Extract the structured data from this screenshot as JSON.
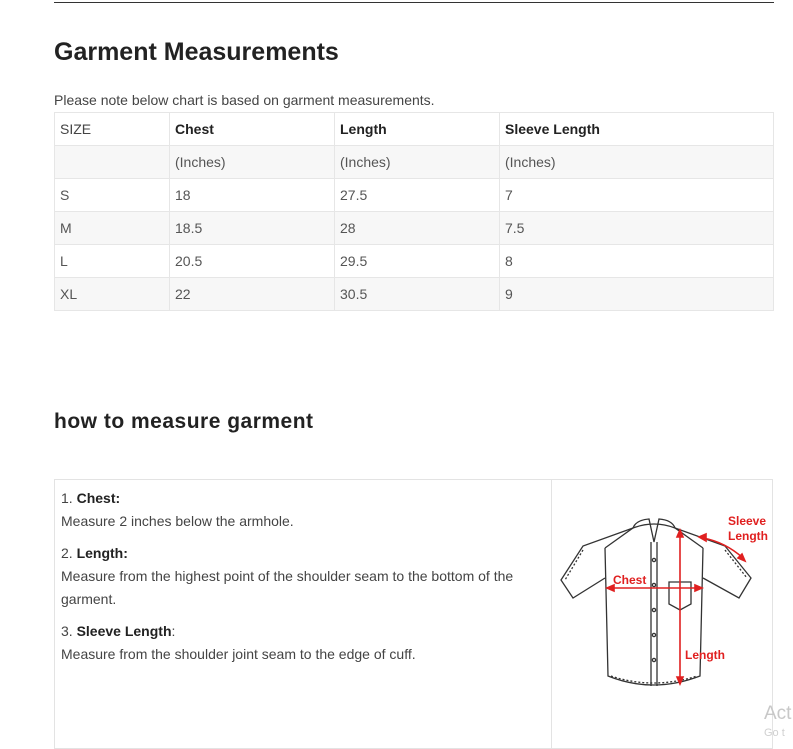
{
  "heading": "Garment Measurements",
  "note": "Please note below chart is based on garment measurements.",
  "table": {
    "headers": [
      "SIZE",
      "Chest",
      "Length",
      "Sleeve Length"
    ],
    "units": [
      "",
      "(Inches)",
      "(Inches)",
      "(Inches)"
    ],
    "rows": [
      [
        "S",
        "18",
        "27.5",
        "7"
      ],
      [
        "M",
        "18.5",
        "28",
        "7.5"
      ],
      [
        "L",
        "20.5",
        "29.5",
        "8"
      ],
      [
        "XL",
        "22",
        "30.5",
        "9"
      ]
    ]
  },
  "howto_heading": "how to measure garment",
  "steps": [
    {
      "num": "1. ",
      "title": "Chest:",
      "suffix": "",
      "desc": "Measure 2 inches below the armhole."
    },
    {
      "num": "2. ",
      "title": "Length:",
      "suffix": "",
      "desc": "Measure from the highest point of the shoulder seam to the bottom of the garment."
    },
    {
      "num": "3. ",
      "title": "Sleeve Length",
      "suffix": ":",
      "desc": "Measure from the shoulder joint seam to the edge of cuff."
    }
  ],
  "diagram": {
    "chest_label": "Chest",
    "length_label": "Length",
    "sleeve_label_1": "Sleeve",
    "sleeve_label_2": "Length",
    "arrow_color": "#e02020"
  },
  "watermark": {
    "line1": "Act",
    "line2": "Go t"
  }
}
